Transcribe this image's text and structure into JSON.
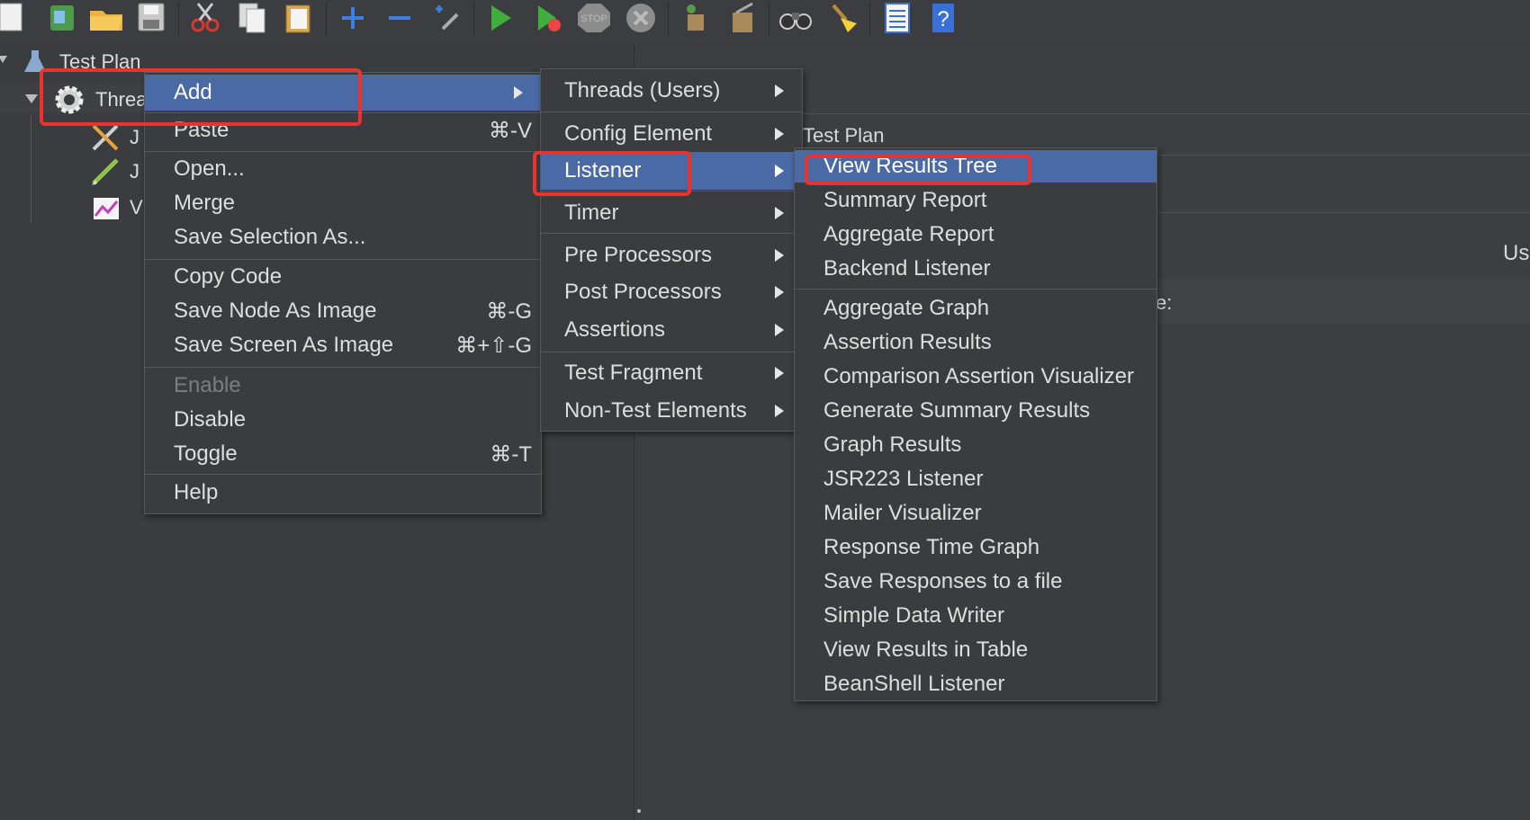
{
  "toolbar": {
    "icons": [
      "new-icon",
      "templates-icon",
      "open-icon",
      "save-icon",
      "cut-icon",
      "copy-icon",
      "paste-icon",
      "expand-icon",
      "collapse-icon",
      "toggle-icon",
      "start-icon",
      "start-no-pauses-icon",
      "stop-icon",
      "shutdown-icon",
      "clear-icon",
      "clear-all-icon",
      "search-icon",
      "reset-search-icon",
      "function-helper-icon",
      "help-icon"
    ],
    "stop_label": "STOP"
  },
  "tree": {
    "root_label": "Test Plan",
    "thread_group_label": "Threa",
    "child1_label": "J",
    "child2_label": "J",
    "child3_label": "V"
  },
  "right_panel": {
    "title": "Test Plan",
    "partial_label_1": "Us",
    "partial_label_2": "e:"
  },
  "context_menu": {
    "items": [
      {
        "label": "Add",
        "shortcut": ""
      },
      {
        "label": "Paste",
        "shortcut": "⌘-V"
      },
      {
        "label": "Open...",
        "shortcut": ""
      },
      {
        "label": "Merge",
        "shortcut": ""
      },
      {
        "label": "Save Selection As...",
        "shortcut": ""
      },
      {
        "label": "Copy Code",
        "shortcut": ""
      },
      {
        "label": "Save Node As Image",
        "shortcut": "⌘-G"
      },
      {
        "label": "Save Screen As Image",
        "shortcut": "⌘+⇧-G"
      },
      {
        "label": "Enable",
        "shortcut": ""
      },
      {
        "label": "Disable",
        "shortcut": ""
      },
      {
        "label": "Toggle",
        "shortcut": "⌘-T"
      },
      {
        "label": "Help",
        "shortcut": ""
      }
    ]
  },
  "add_submenu": {
    "items": [
      {
        "label": "Threads (Users)"
      },
      {
        "label": "Config Element"
      },
      {
        "label": "Listener"
      },
      {
        "label": "Timer"
      },
      {
        "label": "Pre Processors"
      },
      {
        "label": "Post Processors"
      },
      {
        "label": "Assertions"
      },
      {
        "label": "Test Fragment"
      },
      {
        "label": "Non-Test Elements"
      }
    ]
  },
  "listener_submenu": {
    "items": [
      {
        "label": "View Results Tree"
      },
      {
        "label": "Summary Report"
      },
      {
        "label": "Aggregate Report"
      },
      {
        "label": "Backend Listener"
      },
      {
        "label": "Aggregate Graph"
      },
      {
        "label": "Assertion Results"
      },
      {
        "label": "Comparison Assertion Visualizer"
      },
      {
        "label": "Generate Summary Results"
      },
      {
        "label": "Graph Results"
      },
      {
        "label": "JSR223 Listener"
      },
      {
        "label": "Mailer Visualizer"
      },
      {
        "label": "Response Time Graph"
      },
      {
        "label": "Save Responses to a file"
      },
      {
        "label": "Simple Data Writer"
      },
      {
        "label": "View Results in Table"
      },
      {
        "label": "BeanShell Listener"
      }
    ]
  },
  "colors": {
    "highlight": "#4a6aa5",
    "annotation_red": "#e8332e"
  }
}
